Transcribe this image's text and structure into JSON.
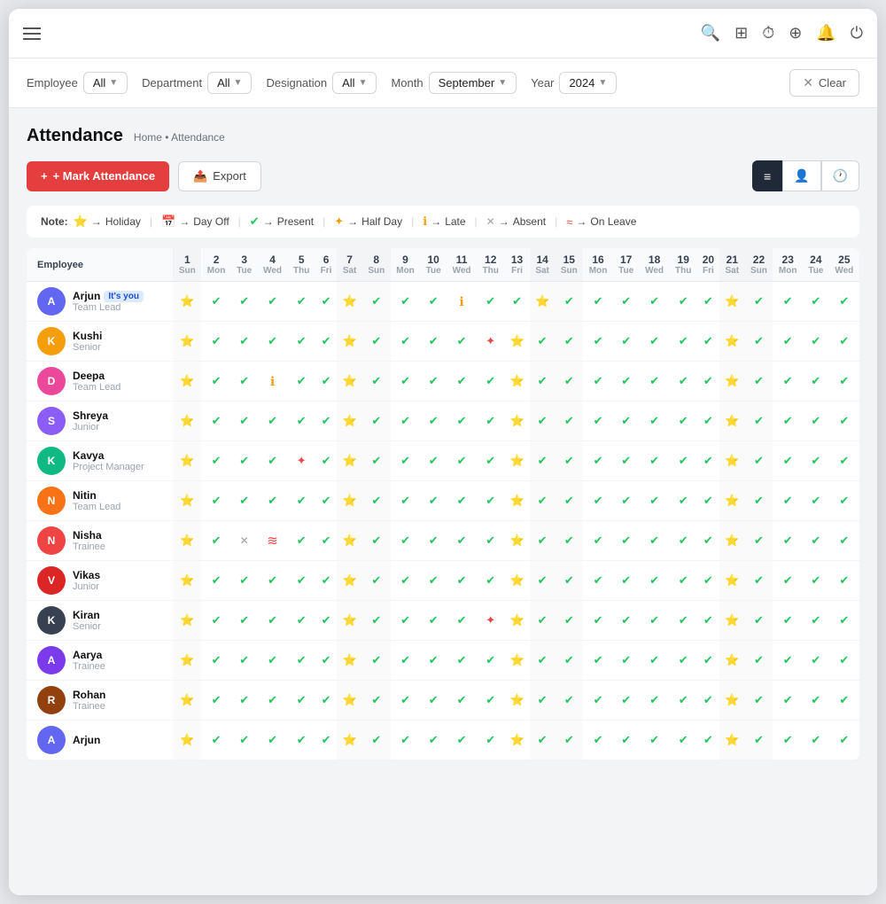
{
  "topbar": {
    "hamburger_label": "Menu",
    "icons": [
      {
        "name": "search-icon",
        "symbol": "🔍"
      },
      {
        "name": "card-icon",
        "symbol": "⊞"
      },
      {
        "name": "clock-icon",
        "symbol": "🕐"
      },
      {
        "name": "add-icon",
        "symbol": "⊕"
      },
      {
        "name": "bell-icon",
        "symbol": "🔔"
      },
      {
        "name": "power-icon",
        "symbol": "⏻"
      }
    ]
  },
  "filters": {
    "employee_label": "Employee",
    "employee_value": "All",
    "department_label": "Department",
    "department_value": "All",
    "designation_label": "Designation",
    "designation_value": "All",
    "month_label": "Month",
    "month_value": "September",
    "year_label": "Year",
    "year_value": "2024",
    "clear_label": "Clear"
  },
  "page": {
    "title": "Attendance",
    "breadcrumb_home": "Home",
    "breadcrumb_sep": "•",
    "breadcrumb_current": "Attendance"
  },
  "actions": {
    "mark_attendance": "+ Mark Attendance",
    "export": "Export"
  },
  "views": [
    {
      "id": "list",
      "icon": "≡",
      "active": true
    },
    {
      "id": "person",
      "icon": "👤",
      "active": false
    },
    {
      "id": "time",
      "icon": "🕐",
      "active": false
    }
  ],
  "legend": {
    "note_label": "Note:",
    "items": [
      {
        "icon": "⭐",
        "label": "Holiday"
      },
      {
        "icon": "📅",
        "label": "Day Off"
      },
      {
        "icon": "✔",
        "label": "Present"
      },
      {
        "icon": "✦",
        "label": "Half Day"
      },
      {
        "icon": "ℹ",
        "label": "Late"
      },
      {
        "icon": "✕",
        "label": "Absent"
      },
      {
        "icon": "≈",
        "label": "On Leave"
      }
    ]
  },
  "table": {
    "emp_col": "Employee",
    "days": [
      {
        "num": "1",
        "name": "Sun"
      },
      {
        "num": "2",
        "name": "Mon"
      },
      {
        "num": "3",
        "name": "Tue"
      },
      {
        "num": "4",
        "name": "Wed"
      },
      {
        "num": "5",
        "name": "Thu"
      },
      {
        "num": "6",
        "name": "Fri"
      },
      {
        "num": "7",
        "name": "Sat"
      },
      {
        "num": "8",
        "name": "Sun"
      },
      {
        "num": "9",
        "name": "Mon"
      },
      {
        "num": "10",
        "name": "Tue"
      },
      {
        "num": "11",
        "name": "Wed"
      },
      {
        "num": "12",
        "name": "Thu"
      },
      {
        "num": "13",
        "name": "Fri"
      },
      {
        "num": "14",
        "name": "Sat"
      },
      {
        "num": "15",
        "name": "Sun"
      },
      {
        "num": "16",
        "name": "Mon"
      },
      {
        "num": "17",
        "name": "Tue"
      },
      {
        "num": "18",
        "name": "Wed"
      },
      {
        "num": "19",
        "name": "Thu"
      },
      {
        "num": "20",
        "name": "Fri"
      },
      {
        "num": "21",
        "name": "Sat"
      },
      {
        "num": "22",
        "name": "Sun"
      },
      {
        "num": "23",
        "name": "Mon"
      },
      {
        "num": "24",
        "name": "Tue"
      },
      {
        "num": "25",
        "name": "Wed"
      }
    ],
    "employees": [
      {
        "name": "Arjun",
        "tag": "It's you",
        "role": "Team Lead",
        "avatar_color": "#6366f1",
        "attendance": [
          "star",
          "check",
          "check",
          "check",
          "check",
          "check",
          "star",
          "check",
          "check",
          "check",
          "late",
          "check",
          "check",
          "star",
          "check",
          "check",
          "check",
          "check",
          "check",
          "check",
          "star",
          "check",
          "check",
          "check",
          "check"
        ]
      },
      {
        "name": "Kushi",
        "tag": "",
        "role": "Senior",
        "avatar_color": "#f59e0b",
        "attendance": [
          "star",
          "check",
          "check",
          "check",
          "check",
          "check",
          "star",
          "check",
          "check",
          "check",
          "check",
          "half-red",
          "star",
          "check",
          "check",
          "check",
          "check",
          "check",
          "check",
          "check",
          "star",
          "check",
          "check",
          "check",
          "check"
        ]
      },
      {
        "name": "Deepa",
        "tag": "",
        "role": "Team Lead",
        "avatar_color": "#ec4899",
        "attendance": [
          "star",
          "check",
          "check",
          "late",
          "check",
          "check",
          "star",
          "check",
          "check",
          "check",
          "check",
          "check",
          "star",
          "check",
          "check",
          "check",
          "check",
          "check",
          "check",
          "check",
          "star",
          "check",
          "check",
          "check",
          "check"
        ]
      },
      {
        "name": "Shreya",
        "tag": "",
        "role": "Junior",
        "avatar_color": "#8b5cf6",
        "attendance": [
          "star",
          "check",
          "check",
          "check",
          "check",
          "check",
          "star",
          "check",
          "check",
          "check",
          "check",
          "check",
          "star",
          "check",
          "check",
          "check",
          "check",
          "check",
          "check",
          "check",
          "star",
          "check",
          "check",
          "check",
          "check"
        ]
      },
      {
        "name": "Kavya",
        "tag": "",
        "role": "Project Manager",
        "avatar_color": "#10b981",
        "attendance": [
          "star",
          "check",
          "check",
          "check",
          "half-red",
          "check",
          "star",
          "check",
          "check",
          "check",
          "check",
          "check",
          "star",
          "check",
          "check",
          "check",
          "check",
          "check",
          "check",
          "check",
          "star",
          "check",
          "check",
          "check",
          "check"
        ]
      },
      {
        "name": "Nitin",
        "tag": "",
        "role": "Team Lead",
        "avatar_color": "#f97316",
        "attendance": [
          "star",
          "check",
          "check",
          "check",
          "check",
          "check",
          "star",
          "check",
          "check",
          "check",
          "check",
          "check",
          "star",
          "check",
          "check",
          "check",
          "check",
          "check",
          "check",
          "check",
          "star",
          "check",
          "check",
          "check",
          "check"
        ]
      },
      {
        "name": "Nisha",
        "tag": "",
        "role": "Trainee",
        "avatar_color": "#ef4444",
        "attendance": [
          "star",
          "check",
          "absent",
          "leave",
          "check",
          "check",
          "star",
          "check",
          "check",
          "check",
          "check",
          "check",
          "star",
          "check",
          "check",
          "check",
          "check",
          "check",
          "check",
          "check",
          "star",
          "check",
          "check",
          "check",
          "check"
        ]
      },
      {
        "name": "Vikas",
        "tag": "",
        "role": "Junior",
        "avatar_color": "#dc2626",
        "attendance": [
          "star",
          "check",
          "check",
          "check",
          "check",
          "check",
          "star",
          "check",
          "check",
          "check",
          "check",
          "check",
          "star",
          "check",
          "check",
          "check",
          "check",
          "check",
          "check",
          "check",
          "star",
          "check",
          "check",
          "check",
          "check"
        ]
      },
      {
        "name": "Kiran",
        "tag": "",
        "role": "Senior",
        "avatar_color": "#374151",
        "attendance": [
          "star",
          "check",
          "check",
          "check",
          "check",
          "check",
          "star",
          "check",
          "check",
          "check",
          "check",
          "half-red",
          "star",
          "check",
          "check",
          "check",
          "check",
          "check",
          "check",
          "check",
          "star",
          "check",
          "check",
          "check",
          "check"
        ]
      },
      {
        "name": "Aarya",
        "tag": "",
        "role": "Trainee",
        "avatar_color": "#7c3aed",
        "attendance": [
          "star",
          "check",
          "check",
          "check",
          "check",
          "check",
          "star",
          "check",
          "check",
          "check",
          "check",
          "check",
          "star",
          "check",
          "check",
          "check",
          "check",
          "check",
          "check",
          "check",
          "star",
          "check",
          "check",
          "check",
          "check"
        ]
      },
      {
        "name": "Rohan",
        "tag": "",
        "role": "Trainee",
        "avatar_color": "#92400e",
        "attendance": [
          "star",
          "check",
          "check",
          "check",
          "check",
          "check",
          "star",
          "check",
          "check",
          "check",
          "check",
          "check",
          "star",
          "check",
          "check",
          "check",
          "check",
          "check",
          "check",
          "check",
          "star",
          "check",
          "check",
          "check",
          "check"
        ]
      },
      {
        "name": "Arjun",
        "tag": "",
        "role": "",
        "avatar_color": "#6366f1",
        "attendance": [
          "star",
          "check",
          "check",
          "check",
          "check",
          "check",
          "star",
          "check",
          "check",
          "check",
          "check",
          "check",
          "star",
          "check",
          "check",
          "check",
          "check",
          "check",
          "check",
          "check",
          "star",
          "check",
          "check",
          "check",
          "check"
        ]
      }
    ]
  }
}
